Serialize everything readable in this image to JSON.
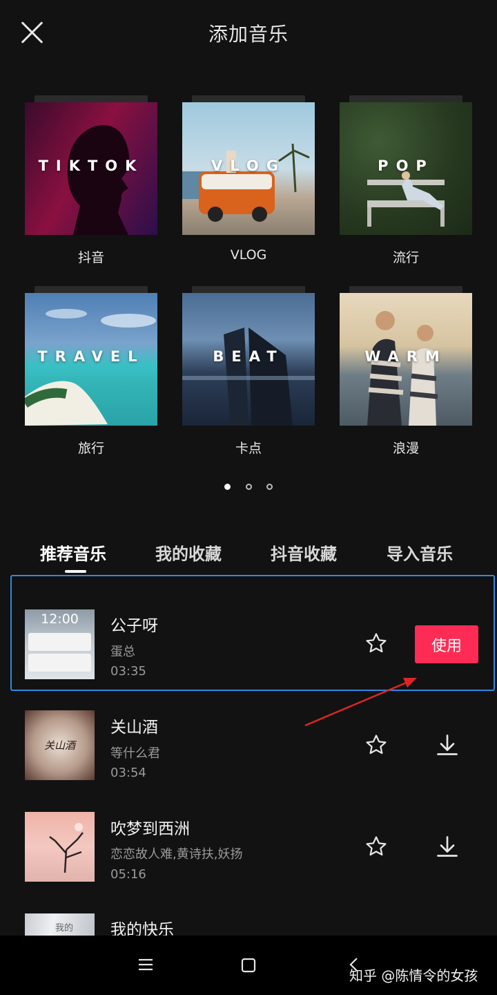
{
  "header": {
    "title": "添加音乐"
  },
  "categories": [
    {
      "en": "TIKTOK",
      "zh": "抖音"
    },
    {
      "en": "VLOG",
      "zh": "VLOG"
    },
    {
      "en": "POP",
      "zh": "流行"
    },
    {
      "en": "TRAVEL",
      "zh": "旅行"
    },
    {
      "en": "BEAT",
      "zh": "卡点"
    },
    {
      "en": "WARM",
      "zh": "浪漫"
    }
  ],
  "pager": {
    "pages": 3,
    "current": 1
  },
  "tabs": [
    {
      "label": "推荐音乐",
      "active": true
    },
    {
      "label": "我的收藏",
      "active": false
    },
    {
      "label": "抖音收藏",
      "active": false
    },
    {
      "label": "导入音乐",
      "active": false
    }
  ],
  "songs": [
    {
      "title": "公子呀",
      "artist": "蛋总",
      "duration": "03:35",
      "thumb_text": "12:00",
      "selected": true,
      "action": "使用"
    },
    {
      "title": "关山酒",
      "artist": "等什么君",
      "duration": "03:54",
      "thumb_text": "关山酒",
      "selected": false
    },
    {
      "title": "吹梦到西洲",
      "artist": "恋恋故人难,黄诗扶,妖扬",
      "duration": "05:16",
      "selected": false
    },
    {
      "title": "我的快乐",
      "thumb_text": "我的",
      "selected": false
    }
  ],
  "watermark": "知乎 @陈情令的女孩",
  "colors": {
    "accent": "#fe2c55",
    "selection": "#2f8ae6",
    "background": "#121212"
  }
}
